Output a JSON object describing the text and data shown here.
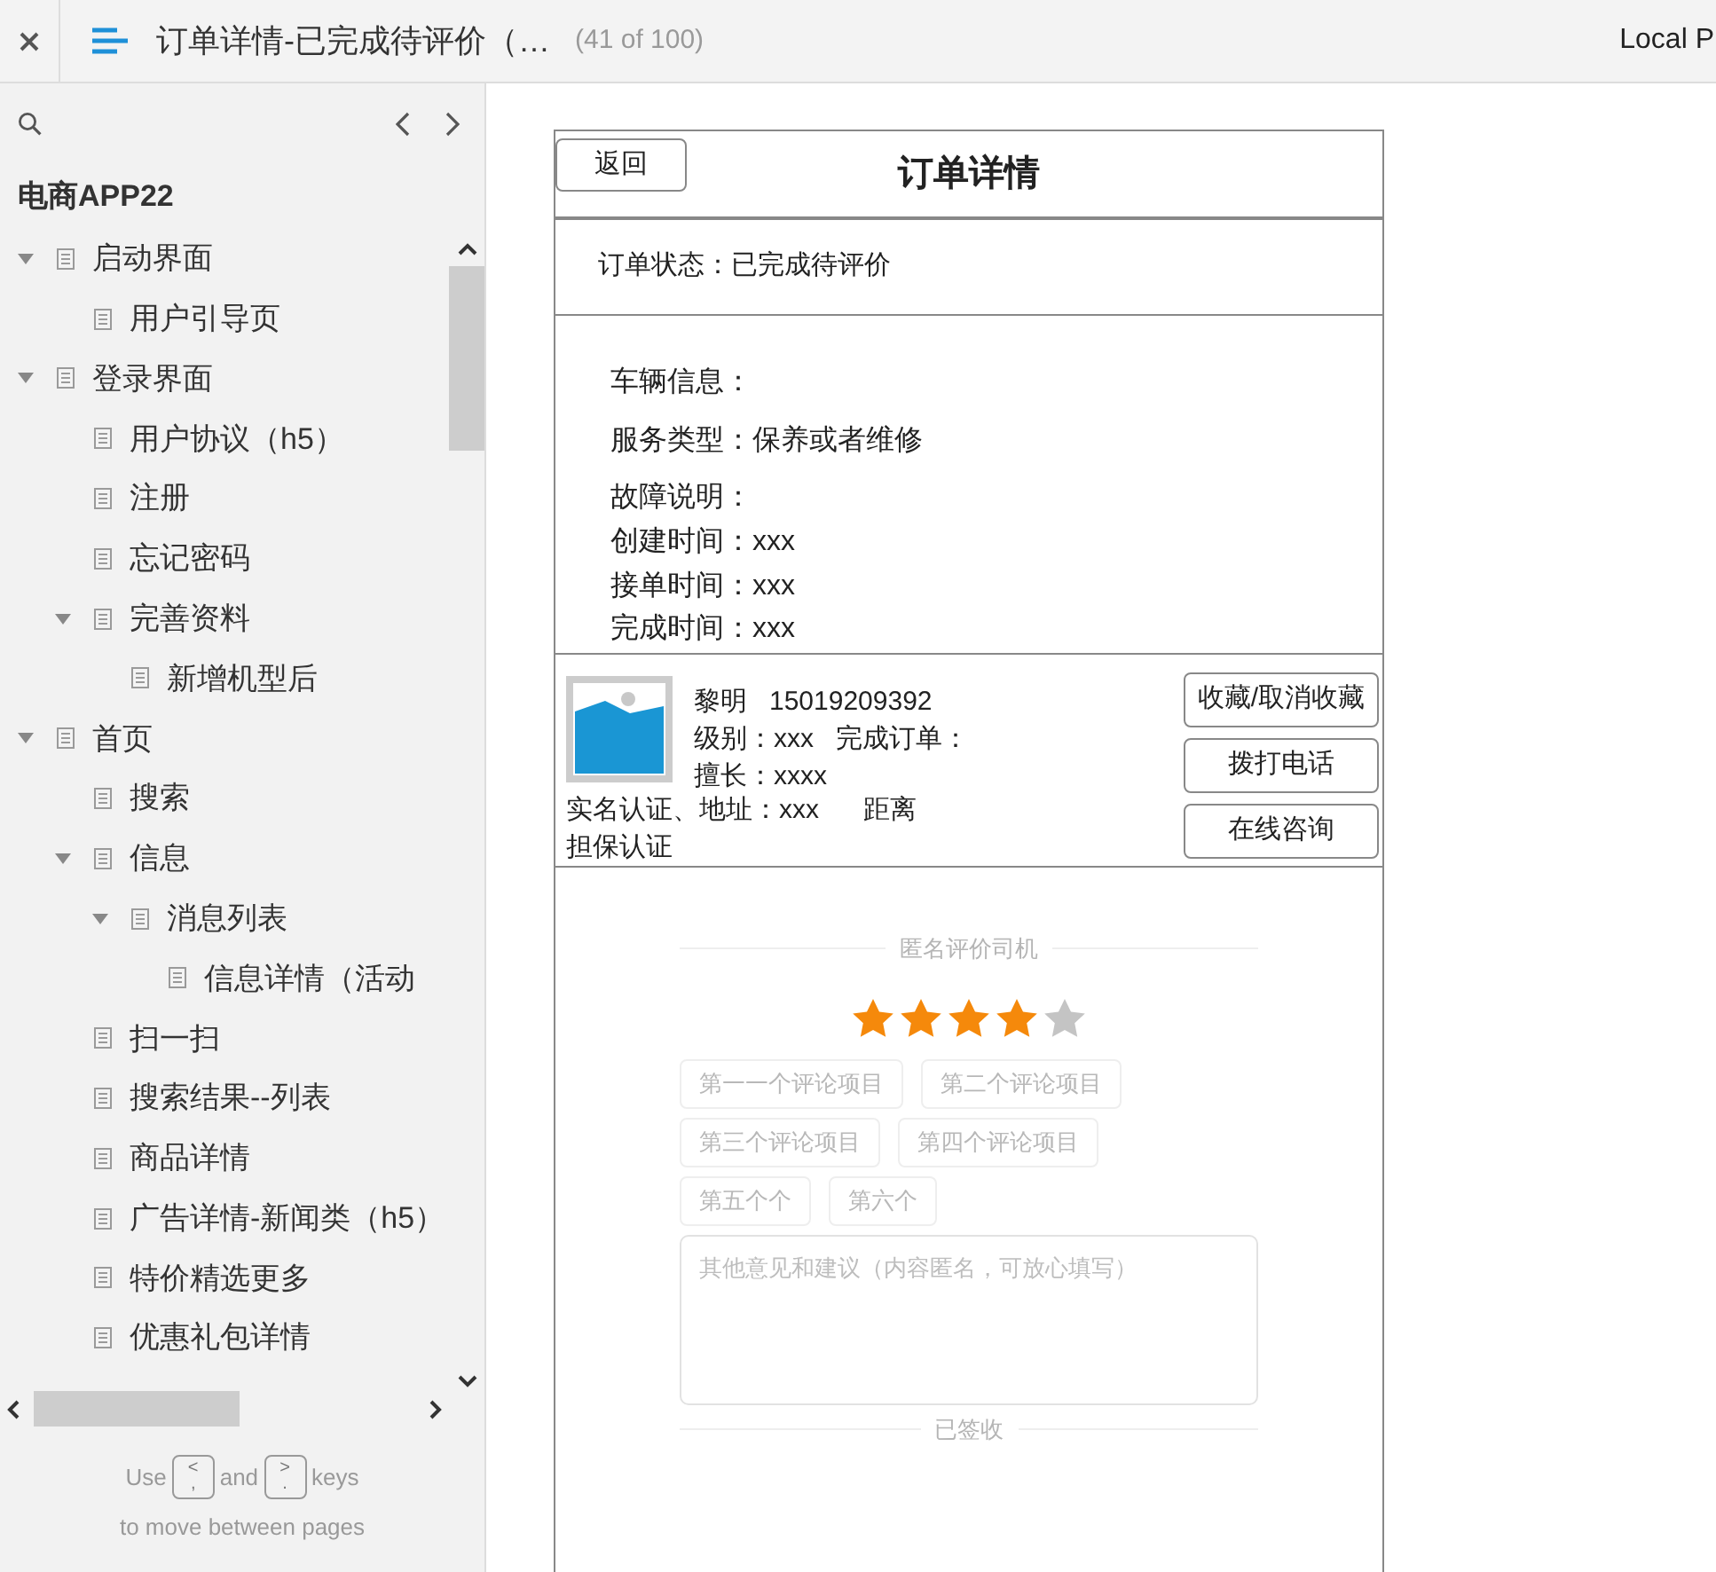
{
  "top_bar": {
    "title": "订单详情-已完成待评价（…",
    "page_count": "(41 of 100)",
    "right_text": "Local P"
  },
  "sidebar": {
    "project": "电商APP22",
    "tree": [
      {
        "label": "启动界面",
        "expanded": true,
        "children": [
          {
            "label": "用户引导页"
          }
        ]
      },
      {
        "label": "登录界面",
        "expanded": true,
        "children": [
          {
            "label": "用户协议（h5）"
          },
          {
            "label": "注册"
          },
          {
            "label": "忘记密码"
          },
          {
            "label": "完善资料",
            "expanded": true,
            "children": [
              {
                "label": "新增机型后"
              }
            ]
          }
        ]
      },
      {
        "label": "首页",
        "expanded": true,
        "children": [
          {
            "label": "搜索"
          },
          {
            "label": "信息",
            "expanded": true,
            "children": [
              {
                "label": "消息列表",
                "expanded": true,
                "children": [
                  {
                    "label": "信息详情（活动"
                  }
                ]
              }
            ]
          },
          {
            "label": "扫一扫"
          },
          {
            "label": "搜索结果--列表"
          },
          {
            "label": "商品详情"
          },
          {
            "label": "广告详情-新闻类（h5）"
          },
          {
            "label": "特价精选更多"
          },
          {
            "label": "优惠礼包详情"
          }
        ]
      }
    ],
    "hint": {
      "use": "Use",
      "prev_key": [
        "<",
        ","
      ],
      "and": "and",
      "next_key": [
        ">",
        "."
      ],
      "keys": "keys",
      "line2": "to move between pages"
    }
  },
  "page": {
    "back_button": "返回",
    "title": "订单详情",
    "status": "订单状态：已完成待评价",
    "info_lines": [
      "车辆信息：",
      "服务类型：保养或者维修",
      "故障说明：",
      "创建时间：xxx",
      "接单时间：xxx",
      "完成时间：xxx"
    ],
    "driver": {
      "name_phone": "黎明   15019209392",
      "level": "级别：xxx   完成订单：",
      "skill": "擅长：xxxx",
      "cert_address": "实名认证、地址：xxx      距离",
      "guarantee": "担保认证"
    },
    "actions": [
      "收藏/取消收藏",
      "拨打电话",
      "在线咨询"
    ],
    "review": {
      "heading": "匿名评价司机",
      "stars": 4,
      "tags": [
        [
          "第一一个评论项目",
          "第二个评论项目"
        ],
        [
          "第三个评论项目",
          "第四个评论项目"
        ],
        [
          "第五个个",
          "第六个"
        ]
      ],
      "placeholder": "其他意见和建议（内容匿名，可放心填写）",
      "footer": "已签收"
    }
  }
}
